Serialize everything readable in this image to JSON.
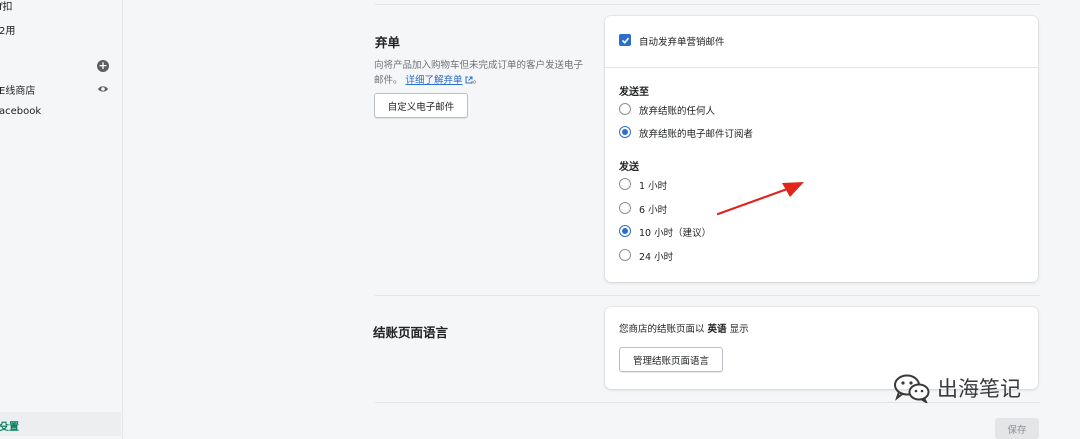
{
  "sidebar": {
    "items": [
      {
        "label": "f扣"
      },
      {
        "label": "2用"
      },
      {
        "label": "E线商店"
      },
      {
        "label": "acebook"
      },
      {
        "label": "殳置"
      }
    ],
    "icons": [
      "plus-circle-icon",
      "eye-icon"
    ]
  },
  "abandoned": {
    "title": "弃单",
    "desc": "向将产品加入购物车但未完成订单的客户发送电子邮件。",
    "link": "详细了解弃单",
    "link_suffix": "。",
    "custom_button": "自定义电子邮件",
    "checkbox_label": "自动发弃单营销邮件",
    "checkbox_checked": true,
    "send_to": {
      "title": "发送至",
      "options": [
        {
          "label": "放弃结账的任何人",
          "checked": false
        },
        {
          "label": "放弃结账的电子邮件订阅者",
          "checked": true
        }
      ]
    },
    "send": {
      "title": "发送",
      "options": [
        {
          "label": "1 小时",
          "checked": false
        },
        {
          "label": "6 小时",
          "checked": false
        },
        {
          "label": "10 小时（建议）",
          "checked": true
        },
        {
          "label": "24 小时",
          "checked": false
        }
      ]
    }
  },
  "checkout_language": {
    "title": "结账页面语言",
    "desc_prefix": "您商店的结账页面以",
    "language": "英语",
    "desc_suffix": "显示",
    "manage_button": "管理结账页面语言"
  },
  "footer": {
    "save_label": "保存"
  },
  "watermark": {
    "text": "出海笔记"
  },
  "colors": {
    "accent": "#2c6ecb",
    "annotation_arrow": "#e0251b",
    "active_nav": "#008060"
  }
}
